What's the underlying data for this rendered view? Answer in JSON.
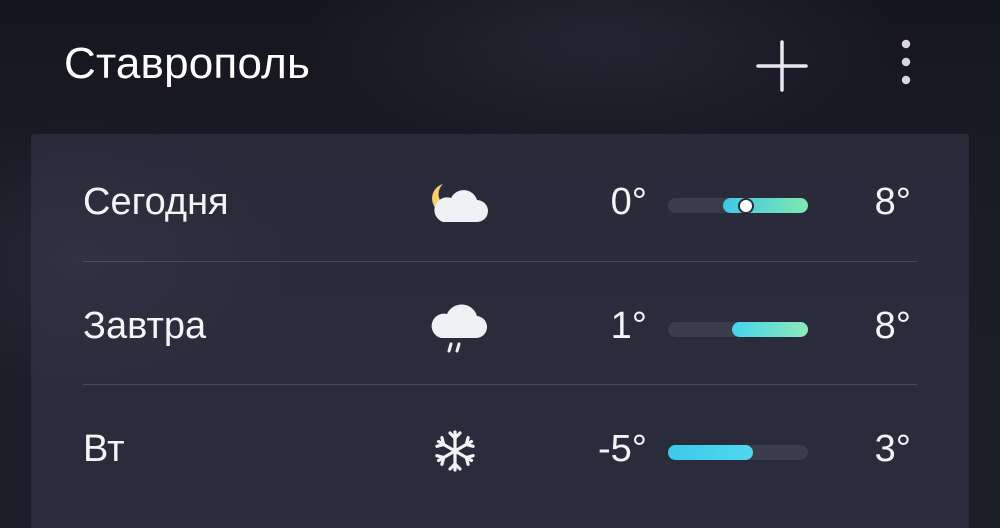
{
  "header": {
    "city": "Ставрополь",
    "add_icon": "plus-icon",
    "more_icon": "more-vertical-icon"
  },
  "forecast": [
    {
      "day": "Сегодня",
      "icon": "partly-cloudy-night-icon",
      "min": "0°",
      "max": "8°",
      "range_start": 0.39,
      "range_end": 1.0,
      "current_marker": 0.56,
      "gradient": [
        "#3fc8e6",
        "#7ee8b0"
      ]
    },
    {
      "day": "Завтра",
      "icon": "rain-icon",
      "min": "1°",
      "max": "8°",
      "range_start": 0.46,
      "range_end": 1.0,
      "gradient": [
        "#45d4ec",
        "#8ee9b8"
      ]
    },
    {
      "day": "Вт",
      "icon": "snowflake-icon",
      "min": "-5°",
      "max": "3°",
      "range_start": 0.0,
      "range_end": 0.61,
      "gradient": [
        "#3ec8ea",
        "#4fd8ee"
      ]
    }
  ],
  "colors": {
    "background": "#1b1c27",
    "card": "#2a2b3a",
    "bar_track": "#3b3d4c",
    "text": "#f4f4f6"
  }
}
